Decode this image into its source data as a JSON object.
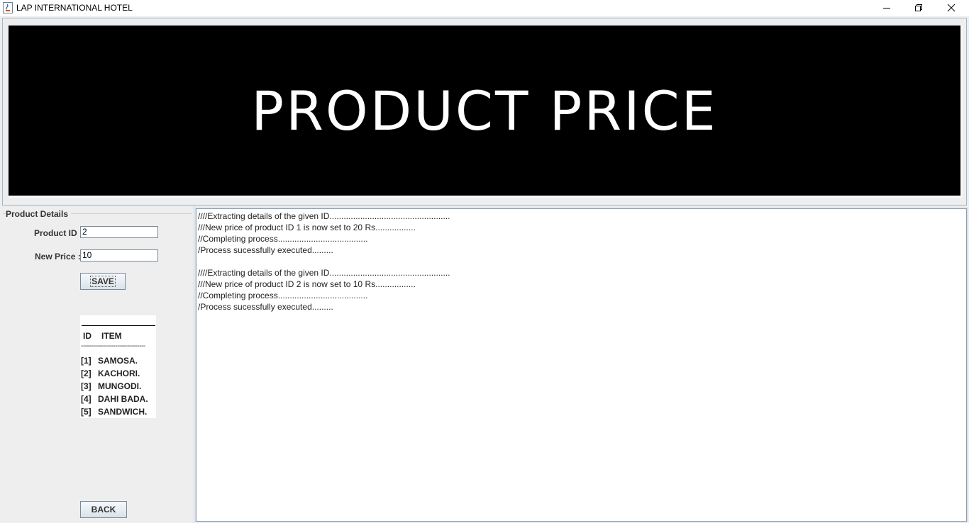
{
  "window": {
    "title": "LAP INTERNATIONAL HOTEL",
    "buttons": [
      "minimize",
      "restore",
      "close"
    ]
  },
  "banner": {
    "text": "PRODUCT PRICE"
  },
  "product_details": {
    "group_title": "Product Details",
    "product_id_label": "Product ID :",
    "product_id_value": "2",
    "new_price_label": "New Price :",
    "new_price_value": "10",
    "save_label": "SAVE",
    "back_label": "BACK"
  },
  "items": {
    "header_id": "ID",
    "header_item": "ITEM",
    "separator": "--------------------------------",
    "rows": [
      {
        "id": "[1]",
        "name": "SAMOSA."
      },
      {
        "id": "[2]",
        "name": "KACHORI."
      },
      {
        "id": "[3]",
        "name": "MUNGODI."
      },
      {
        "id": "[4]",
        "name": "DAHI BADA."
      },
      {
        "id": "[5]",
        "name": "SANDWICH."
      }
    ]
  },
  "log": {
    "lines": [
      "////Extracting details of the given ID...................................................",
      "///New price of product ID 1 is now set to 20 Rs.................",
      "//Completing process......................................",
      "/Process sucessfully executed.........",
      "",
      "////Extracting details of the given ID...................................................",
      "///New price of product ID 2 is now set to 10 Rs.................",
      "//Completing process......................................",
      "/Process sucessfully executed........."
    ]
  }
}
